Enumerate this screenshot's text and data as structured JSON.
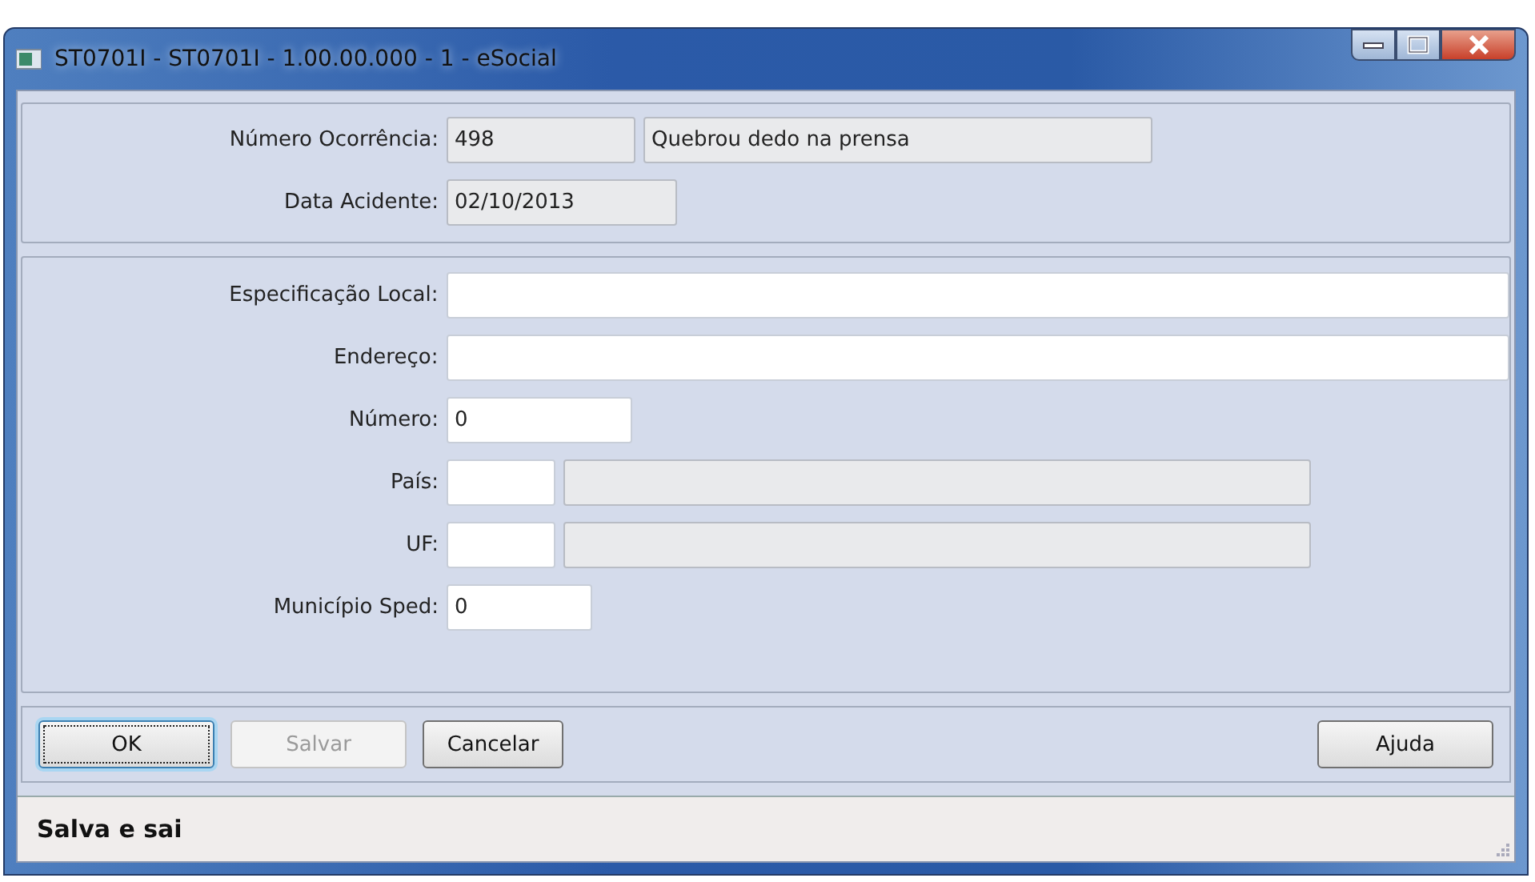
{
  "window": {
    "title": "ST0701I - ST0701I - 1.00.00.000 - 1 - eSocial"
  },
  "header_panel": [
    {
      "label": "Número Ocorrência:",
      "fields": [
        {
          "value": "498",
          "disabled": true
        },
        {
          "value": "Quebrou dedo na prensa",
          "disabled": true
        }
      ]
    },
    {
      "label": "Data Acidente:",
      "fields": [
        {
          "value": "02/10/2013",
          "disabled": true
        }
      ]
    }
  ],
  "detail_panel": [
    {
      "label": "Especificação Local:",
      "fields": [
        {
          "disabled": false
        }
      ]
    },
    {
      "label": "Endereço:",
      "fields": [
        {
          "disabled": false
        }
      ]
    },
    {
      "label": "Número:",
      "fields": [
        {
          "value": "0",
          "disabled": false
        }
      ]
    },
    {
      "label": "País:",
      "fields": [
        {
          "disabled": false
        },
        {
          "disabled": true
        }
      ]
    },
    {
      "label": "UF:",
      "fields": [
        {
          "disabled": false
        },
        {
          "disabled": true
        }
      ]
    },
    {
      "label": "Município Sped:",
      "fields": [
        {
          "value": "0",
          "disabled": false
        }
      ]
    }
  ],
  "buttons": [
    {
      "label": "OK",
      "disabled": false,
      "focused": true
    },
    {
      "label": "Salvar",
      "disabled": true,
      "focused": false
    },
    {
      "label": "Cancelar",
      "disabled": false,
      "focused": false
    }
  ],
  "buttons_right": [
    {
      "label": "Ajuda",
      "disabled": false,
      "focused": false
    }
  ],
  "status_bar": "Salva e sai"
}
